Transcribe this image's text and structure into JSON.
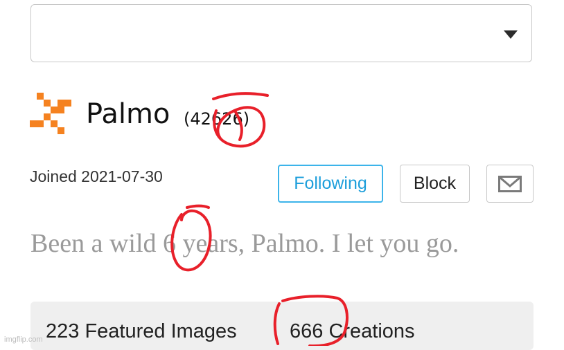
{
  "profile": {
    "username": "Palmo",
    "points": "(42626)",
    "joined": "Joined 2021-07-30",
    "bio": "Been a wild 6 years, Palmo. I let you go."
  },
  "actions": {
    "following_label": "Following",
    "block_label": "Block",
    "message_icon": "envelope-icon"
  },
  "stats": {
    "featured": "223 Featured Images",
    "creations": "666 Creations"
  },
  "watermark": "imgflip.com",
  "colors": {
    "accent": "#1e9fdb",
    "avatar": "#f58220",
    "annotation": "#e8202a",
    "bio_text": "#9a9a9a"
  }
}
